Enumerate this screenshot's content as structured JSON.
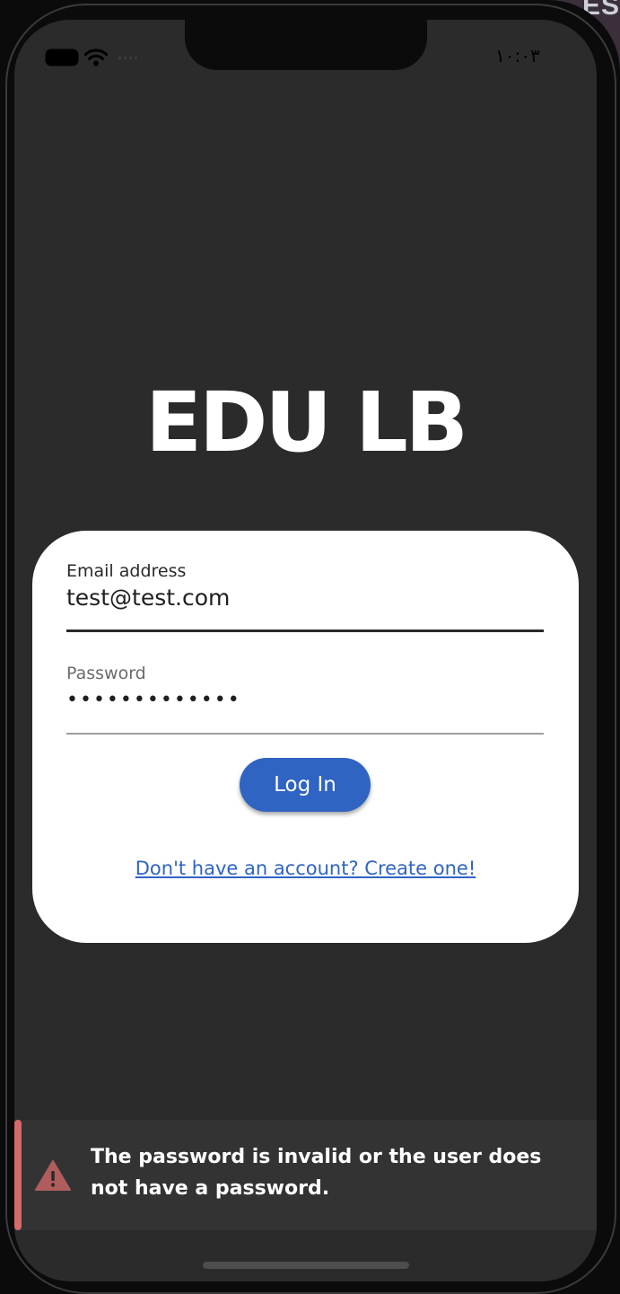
{
  "window": {
    "corner_text": "ES"
  },
  "status_bar": {
    "time": "١٠:٠٣"
  },
  "app": {
    "title": "EDU LB"
  },
  "form": {
    "email_label": "Email address",
    "email_value": "test@test.com",
    "password_label": "Password",
    "password_value": "•••••••••••••",
    "login_button": "Log In",
    "signup_link": "Don't have an account? Create one!"
  },
  "toast": {
    "message": "The password is invalid or the user does not have a password.",
    "icon": "warning-triangle-icon",
    "accent_color": "#d46a6a"
  },
  "colors": {
    "screen_bg": "#2b2b2b",
    "card_bg": "#ffffff",
    "primary": "#2f64c2"
  }
}
